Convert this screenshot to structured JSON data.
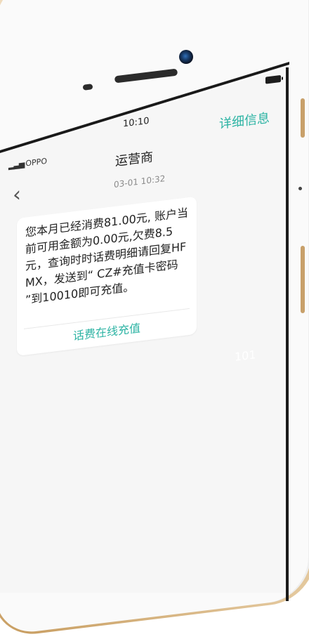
{
  "device": {
    "status_time": "10:10",
    "carrier": "OPPO"
  },
  "header": {
    "title": "运营商",
    "detail_link": "详细信息"
  },
  "message": {
    "timestamp": "03-01  10:32",
    "body": "您本月已经消费81.00元, 账户当前可用金额为0.00元,欠费8.5元，查询时时话费明细请回复HFMX，发送到“ CZ#充值卡密码 ”到10010即可充值。",
    "action_label": "话费在线充值",
    "sender_number": "101"
  },
  "colors": {
    "accent": "#2bb3a3",
    "frame_gold": "#d8b37e"
  }
}
